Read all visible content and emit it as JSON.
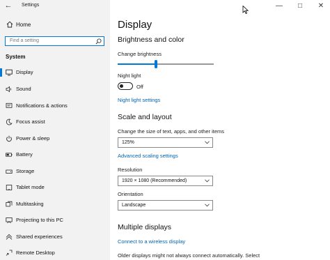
{
  "window": {
    "app_title": "Settings",
    "back_icon": "back-arrow-icon",
    "controls": [
      "minimize-icon",
      "maximize-icon",
      "close-icon"
    ]
  },
  "sidebar": {
    "home_label": "Home",
    "search": {
      "placeholder": "Find a setting"
    },
    "section_label": "System",
    "items": [
      {
        "label": "Display",
        "icon": "monitor-icon",
        "active": true
      },
      {
        "label": "Sound",
        "icon": "speaker-icon"
      },
      {
        "label": "Notifications & actions",
        "icon": "notification-icon"
      },
      {
        "label": "Focus assist",
        "icon": "moon-icon"
      },
      {
        "label": "Power & sleep",
        "icon": "power-icon"
      },
      {
        "label": "Battery",
        "icon": "battery-icon"
      },
      {
        "label": "Storage",
        "icon": "storage-icon"
      },
      {
        "label": "Tablet mode",
        "icon": "tablet-icon"
      },
      {
        "label": "Multitasking",
        "icon": "multitasking-icon"
      },
      {
        "label": "Projecting to this PC",
        "icon": "projector-icon"
      },
      {
        "label": "Shared experiences",
        "icon": "shared-icon"
      },
      {
        "label": "Remote Desktop",
        "icon": "remote-icon"
      }
    ]
  },
  "main": {
    "title": "Display",
    "brightness": {
      "heading": "Brightness and color",
      "slider_label": "Change brightness",
      "brightness_fraction": 0.4
    },
    "night_light": {
      "label": "Night light",
      "state": "Off",
      "settings_link": "Night light settings"
    },
    "scale_layout": {
      "heading": "Scale and layout",
      "size_label": "Change the size of text, apps, and other items",
      "size_value": "125%",
      "advanced_link": "Advanced scaling settings",
      "resolution_label": "Resolution",
      "resolution_value": "1920 × 1080 (Recommended)",
      "orientation_label": "Orientation",
      "orientation_value": "Landscape"
    },
    "multiple_displays": {
      "heading": "Multiple displays",
      "connect_link": "Connect to a wireless display",
      "footer_text": "Older displays might not always connect automatically. Select"
    }
  },
  "colors": {
    "accent": "#0078d7",
    "link": "#0063b1",
    "sidebar_bg": "#f2f2f2"
  }
}
